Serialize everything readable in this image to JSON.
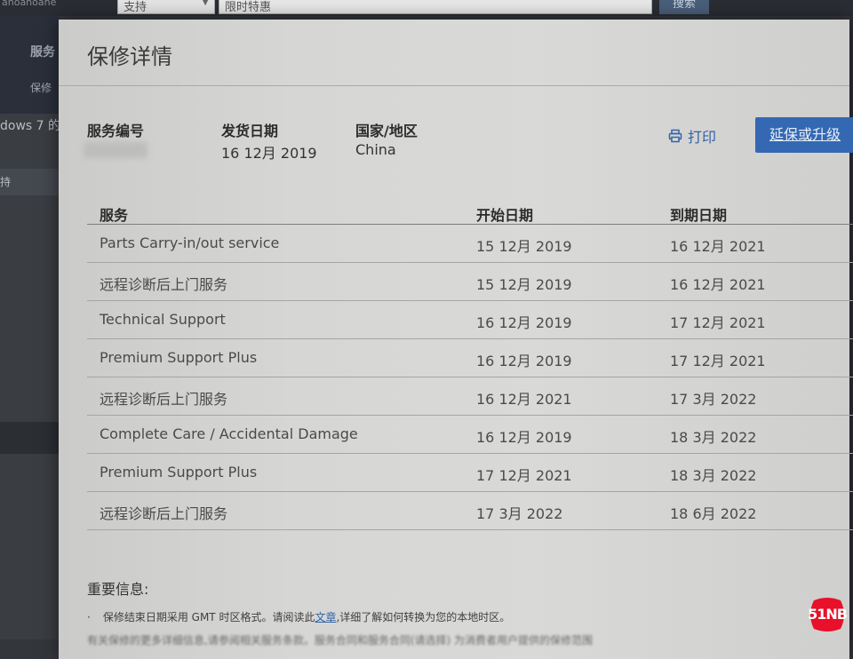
{
  "background": {
    "logo_text": "anoanoane",
    "select_value": "支持",
    "search_placeholder": "限时特惠",
    "search_button": "搜索",
    "nav_item_1": "服务",
    "nav_item_2": "保修",
    "os_text": "dows 7 的",
    "support_text": "持"
  },
  "modal": {
    "title": "保修详情",
    "service_tag_label": "服务编号",
    "ship_date_label": "发货日期",
    "ship_date_value": "16 12月 2019",
    "country_label": "国家/地区",
    "country_value": "China",
    "print_label": "打印",
    "extend_button": "延保或升级"
  },
  "table": {
    "headers": [
      "服务",
      "开始日期",
      "到期日期"
    ],
    "rows": [
      {
        "service": "Parts Carry-in/out service",
        "start": "15 12月 2019",
        "end": "16 12月 2021"
      },
      {
        "service": "远程诊断后上门服务",
        "start": "15 12月 2019",
        "end": "16 12月 2021"
      },
      {
        "service": "Technical Support",
        "start": "16 12月 2019",
        "end": "17 12月 2021"
      },
      {
        "service": "Premium Support Plus",
        "start": "16 12月 2019",
        "end": "17 12月 2021"
      },
      {
        "service": "远程诊断后上门服务",
        "start": "16 12月 2021",
        "end": "17 3月 2022"
      },
      {
        "service": "Complete Care / Accidental Damage",
        "start": "16 12月 2019",
        "end": "18 3月 2022"
      },
      {
        "service": "Premium Support Plus",
        "start": "17 12月 2021",
        "end": "18 3月 2022"
      },
      {
        "service": "远程诊断后上门服务",
        "start": "17 3月 2022",
        "end": "18 6月 2022"
      }
    ]
  },
  "important": {
    "title": "重要信息:",
    "bullet1_before": "保修结束日期采用 GMT 时区格式。请阅读此",
    "bullet1_link": "文章",
    "bullet1_after": ",详细了解如何转换为您的本地时区。",
    "bullet2": "有关保修的更多详细信息,请参阅相关服务条款。服务合同和服务合同(请选择) 为消费者用户提供的保修范围"
  },
  "watermark": {
    "text": "51NB",
    "color": "#e8102a"
  },
  "colors": {
    "accent": "#3468b3",
    "link": "#3263a8"
  }
}
